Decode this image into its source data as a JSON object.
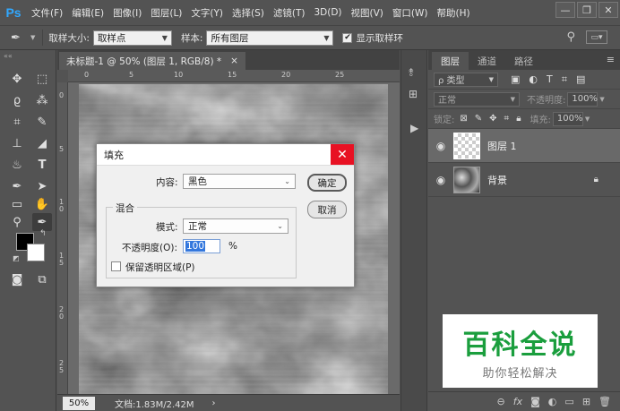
{
  "app": {
    "logo": "Ps"
  },
  "menu": [
    "文件(F)",
    "编辑(E)",
    "图像(I)",
    "图层(L)",
    "文字(Y)",
    "选择(S)",
    "滤镜(T)",
    "3D(D)",
    "视图(V)",
    "窗口(W)",
    "帮助(H)"
  ],
  "window_controls": {
    "minimize": "—",
    "restore": "❐",
    "close": "✕"
  },
  "options": {
    "sample_size_label": "取样大小:",
    "sample_size_value": "取样点",
    "sample_label": "样本:",
    "sample_value": "所有图层",
    "show_ring_label": "显示取样环",
    "show_ring_checked": "✔"
  },
  "document": {
    "tab_title": "未标题-1 @ 50% (图层 1, RGB/8) *",
    "tab_close": "×",
    "ruler_h": [
      "0",
      "5",
      "10",
      "15",
      "20",
      "25"
    ],
    "ruler_v": [
      "0",
      "5",
      "1\n0",
      "1\n5",
      "2\n0",
      "2\n5"
    ],
    "zoom": "50%",
    "doc_info": "文档:1.83M/2.42M",
    "status_arrow": "›"
  },
  "layers_panel": {
    "tabs": [
      "图层",
      "通道",
      "路径"
    ],
    "filter_kind": "ρ 类型",
    "blend_mode": "正常",
    "opacity_label": "不透明度:",
    "opacity_value": "100%",
    "lock_label": "锁定:",
    "fill_label": "填充:",
    "fill_value": "100%",
    "layers": [
      {
        "name": "图层 1",
        "selected": true
      },
      {
        "name": "背景",
        "selected": false
      }
    ],
    "bottom_icons": [
      "link-icon",
      "fx-icon",
      "mask-icon",
      "adjustment-icon",
      "group-icon",
      "new-layer-icon",
      "trash-icon"
    ]
  },
  "watermark": {
    "title": "百科全说",
    "subtitle": "助你轻松解决",
    "color": "#1a9e3d"
  },
  "fill_dialog": {
    "title": "填充",
    "close": "✕",
    "content_label": "内容:",
    "content_value": "黑色",
    "ok": "确定",
    "cancel": "取消",
    "blend_group": "混合",
    "mode_label": "模式:",
    "mode_value": "正常",
    "opacity_label": "不透明度(O):",
    "opacity_value": "100",
    "opacity_unit": "%",
    "preserve_label": "保留透明区域(P)"
  },
  "colors": {
    "accent": "#31a8ff",
    "close_red": "#e81123",
    "panel_bg": "#535353"
  }
}
